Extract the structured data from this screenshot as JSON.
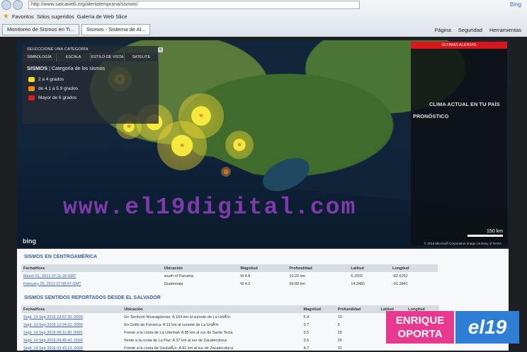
{
  "browser": {
    "url": "http://www.satcaweb.org/alertatemprana/sismos/",
    "search_engine": "Bing",
    "favorites_label": "Favoritos",
    "favorites": [
      "Sitios sugeridos",
      "Galería de Web Slice"
    ],
    "tabs": [
      "Monitoreo de Sismos en Ti...",
      "Sismos - Sistema de Al..."
    ],
    "tools": [
      "Página",
      "Seguridad",
      "Herramientas"
    ]
  },
  "map": {
    "category_prompt": "SELECCIONE UNA CATEGORÍA",
    "tabs": [
      "SIMBOLOGÍA",
      "ESCALA",
      "ESTILO DE VISTA",
      "SATELITE"
    ],
    "legend_title": "SISMOS",
    "legend_subtitle": "| Categoría de los sismos",
    "legend": [
      {
        "label": "2 a 4 grados",
        "color": "#f5e11a"
      },
      {
        "label": "de 4.1 a 5.9 grados",
        "color": "#f08a17"
      },
      {
        "label": "Mayor de 6 grados",
        "color": "#d9201f"
      }
    ],
    "right_panel": {
      "alerts": "ÚLTIMAS ALERTAS",
      "clima": "CLIMA ACTUAL EN TU PAÍS",
      "pronostico": "PRONÓSTICO"
    },
    "watermark": "www.el19digital.com",
    "provider": "bing",
    "scale_label": "150 km",
    "copyright": "© 2016 Microsoft Corporation   Image courtesy of NASA"
  },
  "section1": {
    "title": "SISMOS EN CENTROAMÉRICA",
    "headers": [
      "Fecha/Hora",
      "Ubicación",
      "Magnitud",
      "Profundidad",
      "Latitud",
      "Longitud"
    ],
    "rows": [
      [
        "March 01, 2013 07:11:18 GMT",
        "south of Panama",
        "M 4.8",
        "10.20 km",
        "6.1502",
        "-82.6252"
      ],
      [
        "February 25, 2013 07:08:47 GMT",
        "Guatemala",
        "M 4.2",
        "99.80 km",
        "14.3481",
        "-91.3841"
      ]
    ]
  },
  "section2": {
    "title": "SISMOS SENTIDOS REPORTADOS DESDE EL SALVADOR",
    "headers": [
      "Fecha/Hora",
      "Ubicación",
      "Magnitud",
      "Profundidad",
      "Latitud",
      "Longitud"
    ],
    "rows": [
      [
        "Sept. 14 Sep 2016 23:57:30 .0000",
        "En Territorio Nicaragüense: A 164 km al sureste de La UniÃ³n",
        "5.4",
        "10",
        "",
        ""
      ],
      [
        "Sept. 14 Sep 2016 12:24:31 .0000",
        "En Golfo de Fonseca: A 12 km al sureste de La UniÃ³n",
        "3.7",
        "5",
        "",
        ""
      ],
      [
        "Sept. 14 Sep 2016 08:11:30 .0000",
        "Frente a la costa de La Libertad: A 85 km al sur de Santa Tecla",
        "3.5",
        "20",
        "",
        ""
      ],
      [
        "Sept. 14 Sep 2016 04:45:42 .0000",
        "frente a la costa de La Paz: A 37 km al sur de Zacatecoluca",
        "3.5",
        "26",
        "",
        ""
      ],
      [
        "Sept. 14 Sep 2016 03:43:23 .0000",
        "Frente a la costa de UsulutÃ¡n: A 81 km al sur de Zacatecoluca",
        "4.7",
        "31",
        "",
        ""
      ]
    ]
  },
  "brand": {
    "line1": "ENRIQUE",
    "line2": "OPORTA",
    "logo_text": "el19",
    "left_color": "#e8388f",
    "right_color": "#2e7ed6"
  }
}
